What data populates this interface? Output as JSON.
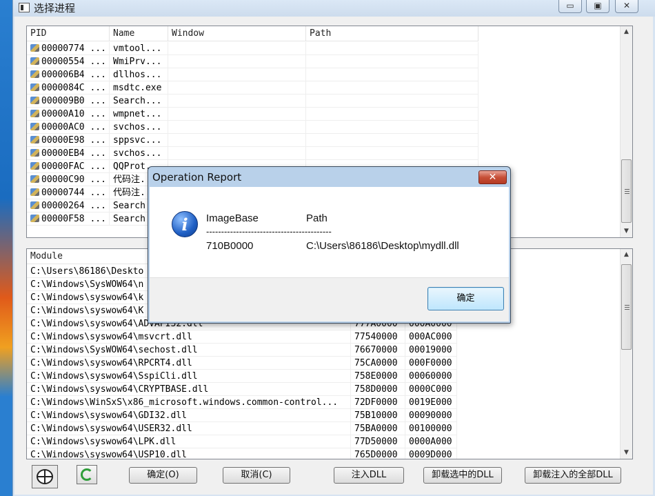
{
  "window": {
    "title": "选择进程",
    "minimize_glyph": "▭",
    "maximize_glyph": "▣",
    "close_glyph": "✕"
  },
  "process_list": {
    "columns": [
      "PID",
      "Name",
      "Window",
      "Path"
    ],
    "rows": [
      {
        "pid": "00000774 ...",
        "name": "vmtool..."
      },
      {
        "pid": "00000554 ...",
        "name": "WmiPrv..."
      },
      {
        "pid": "000006B4 ...",
        "name": "dllhos..."
      },
      {
        "pid": "0000084C ...",
        "name": "msdtc.exe"
      },
      {
        "pid": "000009B0 ...",
        "name": "Search..."
      },
      {
        "pid": "00000A10 ...",
        "name": "wmpnet..."
      },
      {
        "pid": "00000AC0 ...",
        "name": "svchos..."
      },
      {
        "pid": "00000E98 ...",
        "name": "sppsvc..."
      },
      {
        "pid": "00000EB4 ...",
        "name": "svchos..."
      },
      {
        "pid": "00000FAC ...",
        "name": "QQProt..."
      },
      {
        "pid": "00000C90 ...",
        "name": "代码注..."
      },
      {
        "pid": "00000744 ...",
        "name": "代码注..."
      },
      {
        "pid": "00000264 ...",
        "name": "Search..."
      },
      {
        "pid": "00000F58 ...",
        "name": "Search..."
      }
    ]
  },
  "module_list": {
    "columns": [
      "Module",
      "",
      ""
    ],
    "rows": [
      {
        "module": "C:\\Users\\86186\\Deskto",
        "base": "",
        "size": ""
      },
      {
        "module": "C:\\Windows\\SysWOW64\\n",
        "base": "",
        "size": ""
      },
      {
        "module": "C:\\Windows\\syswow64\\k",
        "base": "",
        "size": ""
      },
      {
        "module": "C:\\Windows\\syswow64\\K",
        "base": "",
        "size": ""
      },
      {
        "module": "C:\\Windows\\syswow64\\ADVAPI32.dll",
        "base": "777A0000",
        "size": "000A0000"
      },
      {
        "module": "C:\\Windows\\syswow64\\msvcrt.dll",
        "base": "77540000",
        "size": "000AC000"
      },
      {
        "module": "C:\\Windows\\SysWOW64\\sechost.dll",
        "base": "76670000",
        "size": "00019000"
      },
      {
        "module": "C:\\Windows\\syswow64\\RPCRT4.dll",
        "base": "75CA0000",
        "size": "000F0000"
      },
      {
        "module": "C:\\Windows\\syswow64\\SspiCli.dll",
        "base": "758E0000",
        "size": "00060000"
      },
      {
        "module": "C:\\Windows\\syswow64\\CRYPTBASE.dll",
        "base": "758D0000",
        "size": "0000C000"
      },
      {
        "module": "C:\\Windows\\WinSxS\\x86_microsoft.windows.common-control...",
        "base": "72DF0000",
        "size": "0019E000"
      },
      {
        "module": "C:\\Windows\\syswow64\\GDI32.dll",
        "base": "75B10000",
        "size": "00090000"
      },
      {
        "module": "C:\\Windows\\syswow64\\USER32.dll",
        "base": "75BA0000",
        "size": "00100000"
      },
      {
        "module": "C:\\Windows\\syswow64\\LPK.dll",
        "base": "77D50000",
        "size": "0000A000"
      },
      {
        "module": "C:\\Windows\\syswow64\\USP10.dll",
        "base": "765D0000",
        "size": "0009D000"
      }
    ]
  },
  "buttons": {
    "ok": "确定(O)",
    "cancel": "取消(C)",
    "inject": "注入DLL",
    "unload_selected": "卸载选中的DLL",
    "unload_all": "卸载注入的全部DLL"
  },
  "dialog": {
    "title": "Operation Report",
    "close_glyph": "✕",
    "icon_glyph": "i",
    "header_imagebase": "ImageBase",
    "header_path": "Path",
    "separator": "------------------------------------------",
    "value_imagebase": "710B0000",
    "value_path": "C:\\Users\\86186\\Desktop\\mydll.dll",
    "ok_button": "确定"
  },
  "icons": [
    "app-icon",
    "process-icon",
    "scroll-up-icon",
    "scroll-down-icon",
    "target-icon",
    "refresh-icon",
    "info-icon"
  ]
}
